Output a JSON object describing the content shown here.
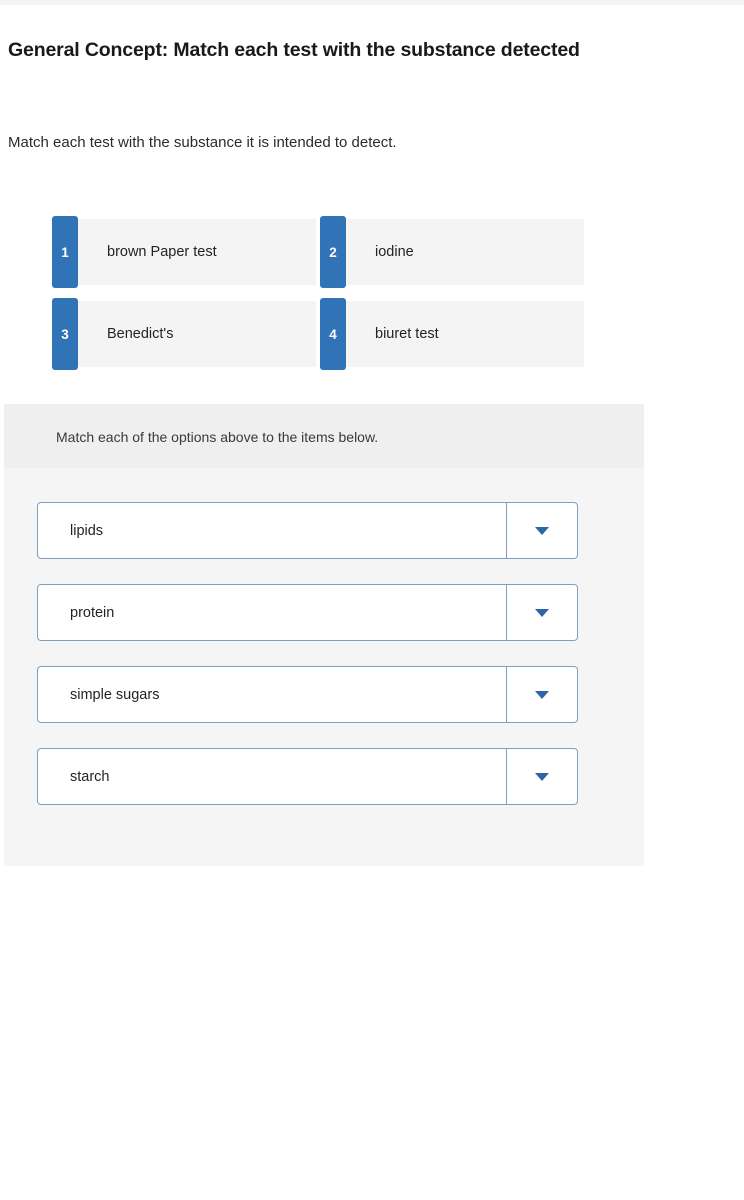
{
  "question": {
    "title": "General Concept: Match each test with the substance detected",
    "prompt": "Match each test with the substance it is intended to detect."
  },
  "options": [
    {
      "number": "1",
      "label": "brown Paper test"
    },
    {
      "number": "2",
      "label": "iodine"
    },
    {
      "number": "3",
      "label": "Benedict's"
    },
    {
      "number": "4",
      "label": "biuret test"
    }
  ],
  "match_panel": {
    "instruction": "Match each of the options above to the items below.",
    "items": [
      {
        "value": "lipids",
        "caret_icon": "chevron-down-icon"
      },
      {
        "value": "protein",
        "caret_icon": "chevron-down-icon"
      },
      {
        "value": "simple sugars",
        "caret_icon": "chevron-down-icon"
      },
      {
        "value": "starch",
        "caret_icon": "chevron-down-icon"
      }
    ]
  },
  "colors": {
    "badge_blue": "#3073b7",
    "dropdown_border": "#7c9fc2",
    "caret_blue": "#2c66a8",
    "panel_bg": "#f5f5f5",
    "panel_header_bg": "#efefef",
    "card_bg": "#f4f4f4"
  }
}
